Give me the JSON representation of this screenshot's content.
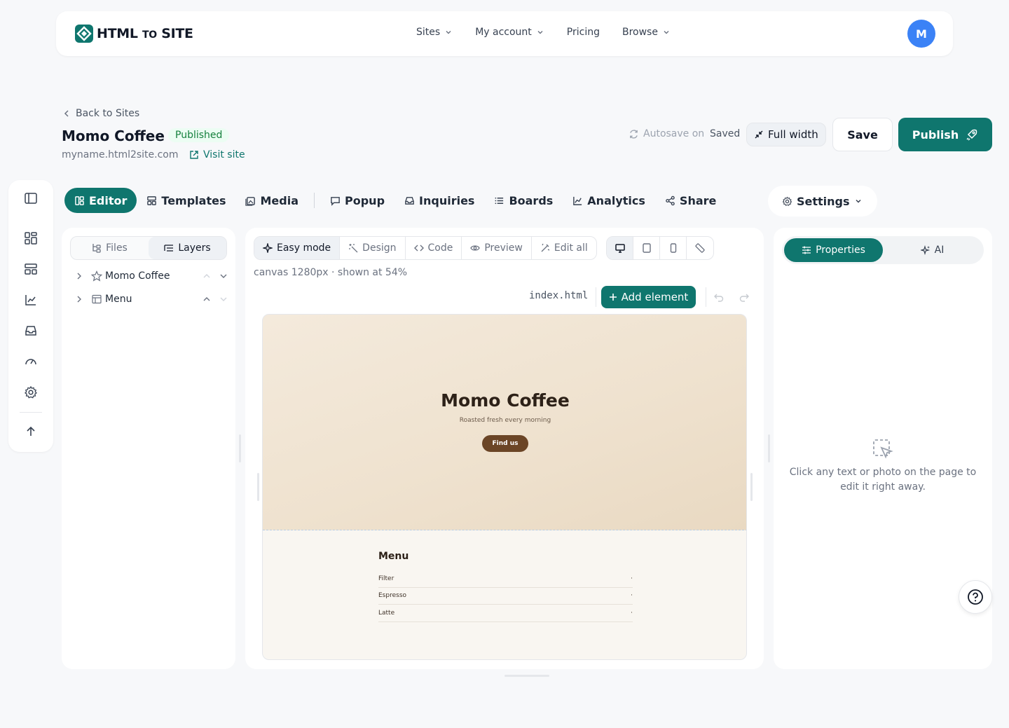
{
  "brand": {
    "logo_main": "HTML",
    "logo_to": "TO",
    "logo_site": "SITE"
  },
  "nav": {
    "links": [
      {
        "label": "Sites",
        "has_dropdown": true
      },
      {
        "label": "My account",
        "has_dropdown": true
      },
      {
        "label": "Pricing",
        "has_dropdown": false
      },
      {
        "label": "Browse",
        "has_dropdown": true
      }
    ],
    "avatar_initial": "M"
  },
  "header": {
    "back_label": "Back to Sites",
    "site_name": "Momo Coffee",
    "status": "Published",
    "domain": "myname.html2site.com",
    "visit_label": "Visit site",
    "autosave_label": "Autosave on",
    "saved_label": "Saved",
    "full_width_label": "Full width",
    "save_label": "Save",
    "publish_label": "Publish"
  },
  "rail": {
    "icons": [
      "sidebar-toggle-icon",
      "dashboard-icon",
      "layout-icon",
      "analytics-icon",
      "inbox-icon",
      "gauge-icon",
      "settings-gear-icon",
      "arrow-up-icon"
    ]
  },
  "tabs": [
    {
      "label": "Editor",
      "icon": "editor-icon",
      "active": true
    },
    {
      "label": "Templates",
      "icon": "templates-icon",
      "active": false
    },
    {
      "label": "Media",
      "icon": "media-icon",
      "active": false
    },
    {
      "label": "Popup",
      "icon": "popup-icon",
      "active": false
    },
    {
      "label": "Inquiries",
      "icon": "inbox-icon",
      "active": false
    },
    {
      "label": "Boards",
      "icon": "list-icon",
      "active": false
    },
    {
      "label": "Analytics",
      "icon": "chart-icon",
      "active": false
    },
    {
      "label": "Share",
      "icon": "share-icon",
      "active": false
    }
  ],
  "settings_label": "Settings",
  "left_panel": {
    "seg": [
      {
        "label": "Files",
        "active": false
      },
      {
        "label": "Layers",
        "active": true
      }
    ],
    "layers": [
      {
        "label": "Momo Coffee",
        "icon": "star-icon"
      },
      {
        "label": "Menu",
        "icon": "section-icon"
      }
    ]
  },
  "editor": {
    "modes": [
      {
        "label": "Easy mode",
        "active": true
      },
      {
        "label": "Design",
        "active": false
      },
      {
        "label": "Code",
        "active": false
      },
      {
        "label": "Preview",
        "active": false
      },
      {
        "label": "Edit all",
        "active": false
      }
    ],
    "devices": [
      "desktop-icon",
      "tablet-icon",
      "mobile-icon",
      "ruler-icon"
    ],
    "canvas_info": "canvas 1280px · shown at 54%",
    "filename": "index.html",
    "add_element_label": "Add element"
  },
  "preview": {
    "hero_title": "Momo Coffee",
    "hero_subtitle": "Roasted fresh every morning",
    "hero_button": "Find us",
    "menu_title": "Menu",
    "menu_items": [
      {
        "name": "Filter",
        "price": "·"
      },
      {
        "name": "Espresso",
        "price": "·"
      },
      {
        "name": "Latte",
        "price": "·"
      }
    ]
  },
  "right_panel": {
    "tabs": [
      {
        "label": "Properties",
        "active": true
      },
      {
        "label": "AI",
        "active": false
      }
    ],
    "empty_text": "Click any text or photo on the page to edit it right away."
  },
  "colors": {
    "accent": "#0f766e",
    "avatar": "#3b82f6",
    "status_green": "#15803d",
    "hero_button": "#6b4526"
  }
}
